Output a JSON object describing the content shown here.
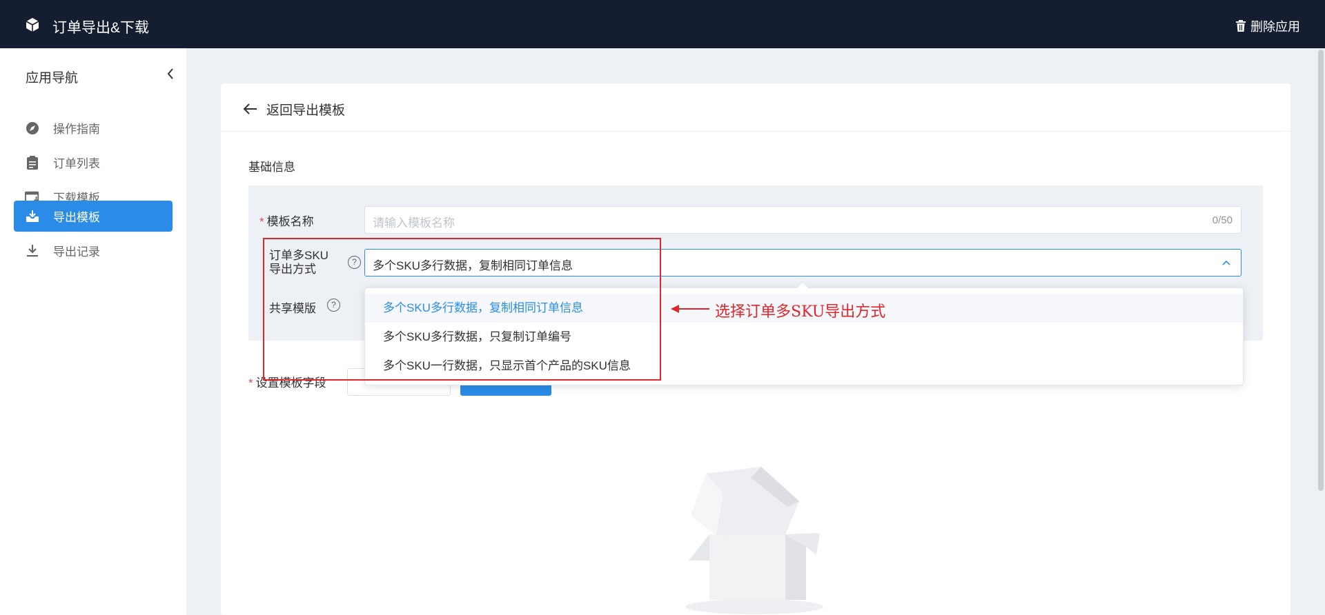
{
  "header": {
    "app_title": "订单导出&下载",
    "delete_app_label": "删除应用"
  },
  "sidebar": {
    "title": "应用导航",
    "items": [
      {
        "label": "操作指南",
        "icon": "compass-icon"
      },
      {
        "label": "订单列表",
        "icon": "clipboard-icon"
      },
      {
        "label": "下载模板",
        "icon": "download-template-icon"
      },
      {
        "label": "导出模板",
        "icon": "export-tray-icon",
        "active": true
      },
      {
        "label": "导出记录",
        "icon": "download-arrow-icon"
      }
    ]
  },
  "page": {
    "back_label": "返回导出模板",
    "section_title": "基础信息"
  },
  "form": {
    "template_name": {
      "label": "模板名称",
      "placeholder": "请输入模板名称",
      "counter": "0/50"
    },
    "multi_sku": {
      "label_line1": "订单多SKU",
      "label_line2": "导出方式",
      "value": "多个SKU多行数据，复制相同订单信息"
    },
    "share_template": {
      "label": "共享模版"
    },
    "template_fields": {
      "label": "设置模板字段"
    }
  },
  "dropdown": {
    "options": [
      {
        "label": "多个SKU多行数据，复制相同订单信息",
        "selected": true
      },
      {
        "label": "多个SKU多行数据，只复制订单编号",
        "selected": false
      },
      {
        "label": "多个SKU一行数据，只显示首个产品的SKU信息",
        "selected": false
      }
    ]
  },
  "annotation": {
    "text": "选择订单多SKU导出方式",
    "color": "#e0262d"
  },
  "colors": {
    "topbar": "#151d30",
    "accent": "#2a8ce6",
    "background": "#edf0f4"
  }
}
